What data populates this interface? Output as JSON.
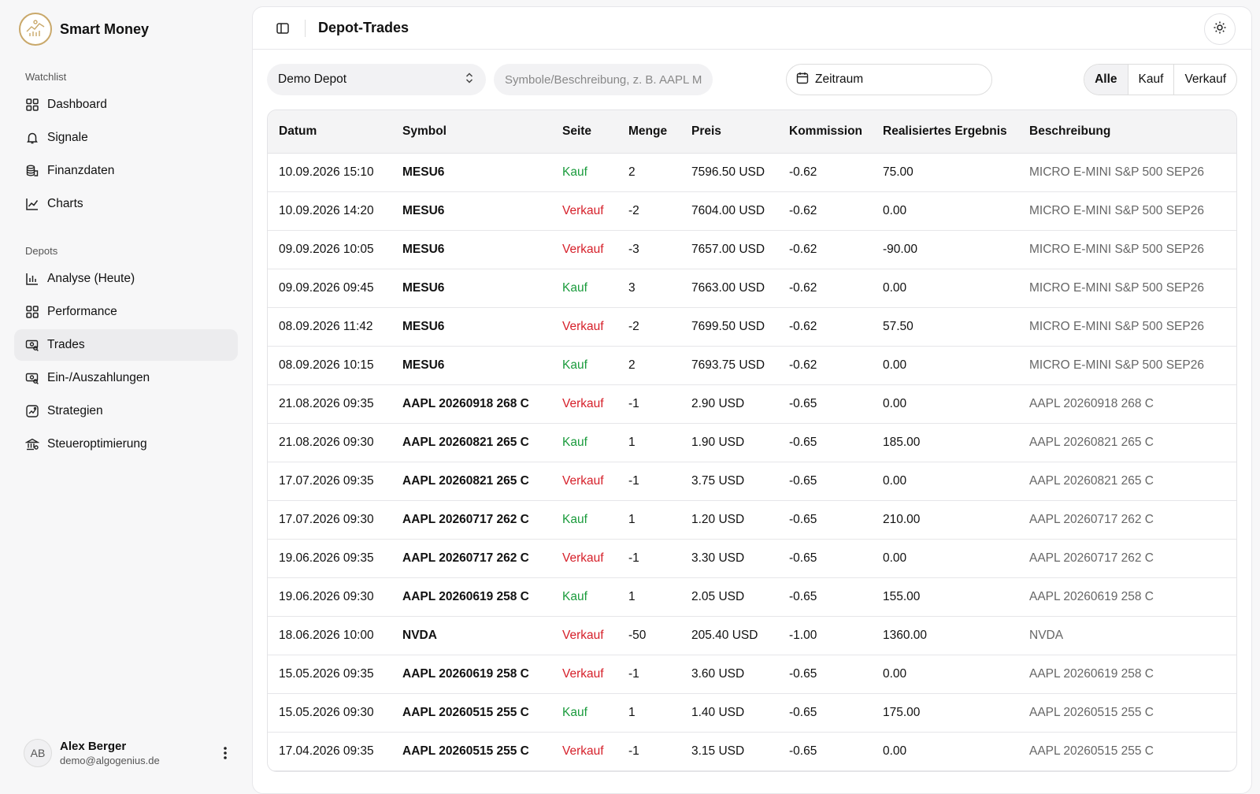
{
  "brand": {
    "name": "Smart Money"
  },
  "sidebar": {
    "sections": [
      {
        "label": "Watchlist",
        "items": [
          {
            "label": "Dashboard",
            "icon": "grid-icon"
          },
          {
            "label": "Signale",
            "icon": "bell-icon"
          },
          {
            "label": "Finanzdaten",
            "icon": "coins-icon"
          },
          {
            "label": "Charts",
            "icon": "line-chart-icon"
          }
        ]
      },
      {
        "label": "Depots",
        "items": [
          {
            "label": "Analyse (Heute)",
            "icon": "bar-chart-icon"
          },
          {
            "label": "Performance",
            "icon": "grid-icon"
          },
          {
            "label": "Trades",
            "icon": "banknote-search-icon",
            "active": true
          },
          {
            "label": "Ein-/Auszahlungen",
            "icon": "banknote-search-icon"
          },
          {
            "label": "Strategien",
            "icon": "chart-box-icon"
          },
          {
            "label": "Steueroptimierung",
            "icon": "bank-icon"
          }
        ]
      }
    ]
  },
  "user": {
    "initials": "AB",
    "name": "Alex Berger",
    "email": "demo@algogenius.de"
  },
  "header": {
    "title": "Depot-Trades"
  },
  "toolbar": {
    "depot_select": "Demo Depot",
    "search_placeholder": "Symbole/Beschreibung, z. B. AAPL M",
    "date_range": "Zeitraum",
    "filters": [
      "Alle",
      "Kauf",
      "Verkauf"
    ],
    "active_filter": "Alle"
  },
  "table": {
    "columns": [
      "Datum",
      "Symbol",
      "Seite",
      "Menge",
      "Preis",
      "Kommission",
      "Realisiertes Ergebnis",
      "Beschreibung"
    ],
    "rows": [
      {
        "datum": "10.09.2026 15:10",
        "symbol": "MESU6",
        "seite": "Kauf",
        "menge": "2",
        "preis": "7596.50 USD",
        "kommission": "-0.62",
        "ergebnis": "75.00",
        "beschreibung": "MICRO E-MINI S&P 500 SEP26"
      },
      {
        "datum": "10.09.2026 14:20",
        "symbol": "MESU6",
        "seite": "Verkauf",
        "menge": "-2",
        "preis": "7604.00 USD",
        "kommission": "-0.62",
        "ergebnis": "0.00",
        "beschreibung": "MICRO E-MINI S&P 500 SEP26"
      },
      {
        "datum": "09.09.2026 10:05",
        "symbol": "MESU6",
        "seite": "Verkauf",
        "menge": "-3",
        "preis": "7657.00 USD",
        "kommission": "-0.62",
        "ergebnis": "-90.00",
        "beschreibung": "MICRO E-MINI S&P 500 SEP26"
      },
      {
        "datum": "09.09.2026 09:45",
        "symbol": "MESU6",
        "seite": "Kauf",
        "menge": "3",
        "preis": "7663.00 USD",
        "kommission": "-0.62",
        "ergebnis": "0.00",
        "beschreibung": "MICRO E-MINI S&P 500 SEP26"
      },
      {
        "datum": "08.09.2026 11:42",
        "symbol": "MESU6",
        "seite": "Verkauf",
        "menge": "-2",
        "preis": "7699.50 USD",
        "kommission": "-0.62",
        "ergebnis": "57.50",
        "beschreibung": "MICRO E-MINI S&P 500 SEP26"
      },
      {
        "datum": "08.09.2026 10:15",
        "symbol": "MESU6",
        "seite": "Kauf",
        "menge": "2",
        "preis": "7693.75 USD",
        "kommission": "-0.62",
        "ergebnis": "0.00",
        "beschreibung": "MICRO E-MINI S&P 500 SEP26"
      },
      {
        "datum": "21.08.2026 09:35",
        "symbol": "AAPL 20260918 268 C",
        "seite": "Verkauf",
        "menge": "-1",
        "preis": "2.90 USD",
        "kommission": "-0.65",
        "ergebnis": "0.00",
        "beschreibung": "AAPL 20260918 268 C"
      },
      {
        "datum": "21.08.2026 09:30",
        "symbol": "AAPL 20260821 265 C",
        "seite": "Kauf",
        "menge": "1",
        "preis": "1.90 USD",
        "kommission": "-0.65",
        "ergebnis": "185.00",
        "beschreibung": "AAPL 20260821 265 C"
      },
      {
        "datum": "17.07.2026 09:35",
        "symbol": "AAPL 20260821 265 C",
        "seite": "Verkauf",
        "menge": "-1",
        "preis": "3.75 USD",
        "kommission": "-0.65",
        "ergebnis": "0.00",
        "beschreibung": "AAPL 20260821 265 C"
      },
      {
        "datum": "17.07.2026 09:30",
        "symbol": "AAPL 20260717 262 C",
        "seite": "Kauf",
        "menge": "1",
        "preis": "1.20 USD",
        "kommission": "-0.65",
        "ergebnis": "210.00",
        "beschreibung": "AAPL 20260717 262 C"
      },
      {
        "datum": "19.06.2026 09:35",
        "symbol": "AAPL 20260717 262 C",
        "seite": "Verkauf",
        "menge": "-1",
        "preis": "3.30 USD",
        "kommission": "-0.65",
        "ergebnis": "0.00",
        "beschreibung": "AAPL 20260717 262 C"
      },
      {
        "datum": "19.06.2026 09:30",
        "symbol": "AAPL 20260619 258 C",
        "seite": "Kauf",
        "menge": "1",
        "preis": "2.05 USD",
        "kommission": "-0.65",
        "ergebnis": "155.00",
        "beschreibung": "AAPL 20260619 258 C"
      },
      {
        "datum": "18.06.2026 10:00",
        "symbol": "NVDA",
        "seite": "Verkauf",
        "menge": "-50",
        "preis": "205.40 USD",
        "kommission": "-1.00",
        "ergebnis": "1360.00",
        "beschreibung": "NVDA"
      },
      {
        "datum": "15.05.2026 09:35",
        "symbol": "AAPL 20260619 258 C",
        "seite": "Verkauf",
        "menge": "-1",
        "preis": "3.60 USD",
        "kommission": "-0.65",
        "ergebnis": "0.00",
        "beschreibung": "AAPL 20260619 258 C"
      },
      {
        "datum": "15.05.2026 09:30",
        "symbol": "AAPL 20260515 255 C",
        "seite": "Kauf",
        "menge": "1",
        "preis": "1.40 USD",
        "kommission": "-0.65",
        "ergebnis": "175.00",
        "beschreibung": "AAPL 20260515 255 C"
      },
      {
        "datum": "17.04.2026 09:35",
        "symbol": "AAPL 20260515 255 C",
        "seite": "Verkauf",
        "menge": "-1",
        "preis": "3.15 USD",
        "kommission": "-0.65",
        "ergebnis": "0.00",
        "beschreibung": "AAPL 20260515 255 C"
      }
    ]
  },
  "colors": {
    "buy": "#1a9b3c",
    "sell": "#d6202a",
    "accent": "#c9a86a"
  }
}
